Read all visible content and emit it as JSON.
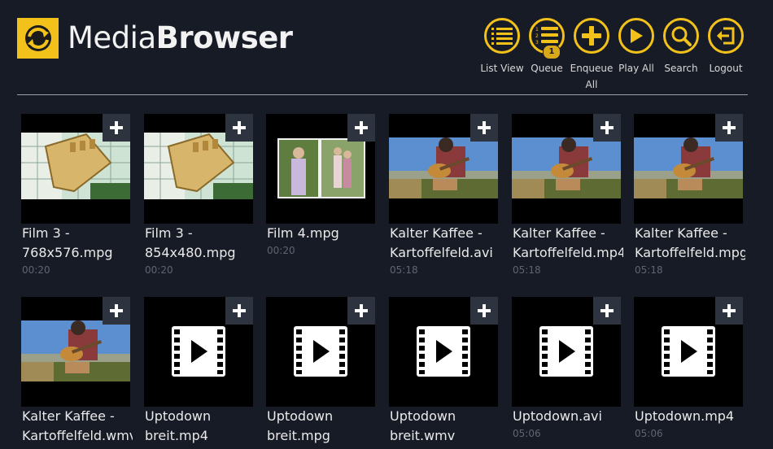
{
  "app": {
    "title_light": "Media",
    "title_bold": "Browser"
  },
  "toolbar": [
    {
      "id": "list-view",
      "label": "List View",
      "icon": "list-icon"
    },
    {
      "id": "queue",
      "label": "Queue",
      "icon": "numbered-list-icon",
      "badge": "1"
    },
    {
      "id": "enqueue-all",
      "label": "Enqueue All",
      "icon": "plus-icon"
    },
    {
      "id": "play-all",
      "label": "Play All",
      "icon": "play-icon"
    },
    {
      "id": "search",
      "label": "Search",
      "icon": "search-icon"
    },
    {
      "id": "logout",
      "label": "Logout",
      "icon": "logout-icon"
    }
  ],
  "colors": {
    "accent": "#f2c21b",
    "background": "#171b26",
    "tile_button": "#2e3340",
    "duration_text": "#5e6472"
  },
  "media": [
    {
      "title_line1": "Film 3 -",
      "title_line2": "768x576.mpg",
      "duration": "00:20",
      "thumb": "box-photo"
    },
    {
      "title_line1": "Film 3 -",
      "title_line2": "854x480.mpg",
      "duration": "00:20",
      "thumb": "box-photo"
    },
    {
      "title_line1": "Film 4.mpg",
      "title_line2": "",
      "duration": "00:20",
      "thumb": "people-photo"
    },
    {
      "title_line1": "Kalter Kaffee -",
      "title_line2": "Kartoffelfeld.avi",
      "duration": "05:18",
      "thumb": "guitar-photo"
    },
    {
      "title_line1": "Kalter Kaffee -",
      "title_line2": "Kartoffelfeld.mp4",
      "duration": "05:18",
      "thumb": "guitar-photo"
    },
    {
      "title_line1": "Kalter Kaffee -",
      "title_line2": "Kartoffelfeld.mpg",
      "duration": "05:18",
      "thumb": "guitar-photo"
    },
    {
      "title_line1": "Kalter Kaffee -",
      "title_line2": "Kartoffelfeld.wmv",
      "duration": "",
      "thumb": "guitar-photo"
    },
    {
      "title_line1": "Uptodown",
      "title_line2": "breit.mp4",
      "duration": "",
      "thumb": "video-icon"
    },
    {
      "title_line1": "Uptodown",
      "title_line2": "breit.mpg",
      "duration": "",
      "thumb": "video-icon"
    },
    {
      "title_line1": "Uptodown",
      "title_line2": "breit.wmv",
      "duration": "",
      "thumb": "video-icon"
    },
    {
      "title_line1": "Uptodown.avi",
      "title_line2": "",
      "duration": "05:06",
      "thumb": "video-icon"
    },
    {
      "title_line1": "Uptodown.mp4",
      "title_line2": "",
      "duration": "05:06",
      "thumb": "video-icon"
    }
  ]
}
